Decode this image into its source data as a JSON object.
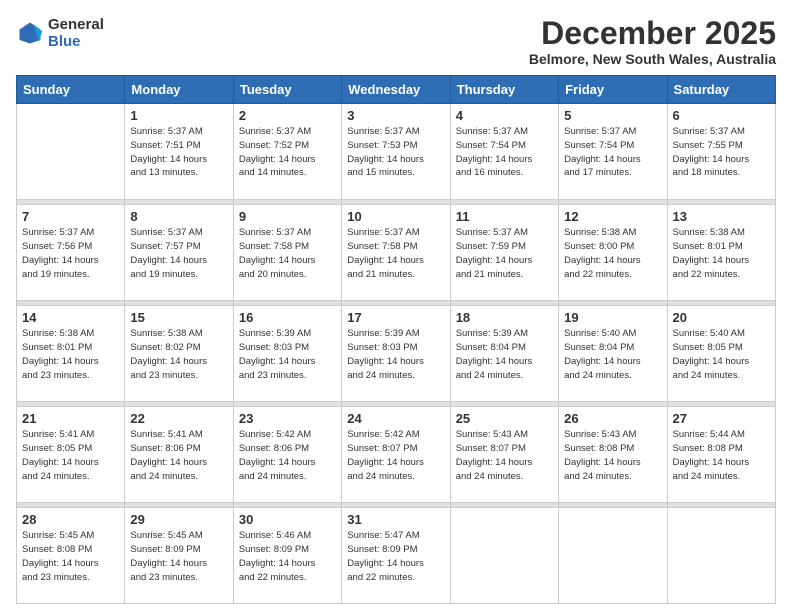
{
  "logo": {
    "line1": "General",
    "line2": "Blue"
  },
  "title": "December 2025",
  "subtitle": "Belmore, New South Wales, Australia",
  "weekdays": [
    "Sunday",
    "Monday",
    "Tuesday",
    "Wednesday",
    "Thursday",
    "Friday",
    "Saturday"
  ],
  "weeks": [
    [
      {
        "day": "",
        "info": ""
      },
      {
        "day": "1",
        "info": "Sunrise: 5:37 AM\nSunset: 7:51 PM\nDaylight: 14 hours\nand 13 minutes."
      },
      {
        "day": "2",
        "info": "Sunrise: 5:37 AM\nSunset: 7:52 PM\nDaylight: 14 hours\nand 14 minutes."
      },
      {
        "day": "3",
        "info": "Sunrise: 5:37 AM\nSunset: 7:53 PM\nDaylight: 14 hours\nand 15 minutes."
      },
      {
        "day": "4",
        "info": "Sunrise: 5:37 AM\nSunset: 7:54 PM\nDaylight: 14 hours\nand 16 minutes."
      },
      {
        "day": "5",
        "info": "Sunrise: 5:37 AM\nSunset: 7:54 PM\nDaylight: 14 hours\nand 17 minutes."
      },
      {
        "day": "6",
        "info": "Sunrise: 5:37 AM\nSunset: 7:55 PM\nDaylight: 14 hours\nand 18 minutes."
      }
    ],
    [
      {
        "day": "7",
        "info": "Sunrise: 5:37 AM\nSunset: 7:56 PM\nDaylight: 14 hours\nand 19 minutes."
      },
      {
        "day": "8",
        "info": "Sunrise: 5:37 AM\nSunset: 7:57 PM\nDaylight: 14 hours\nand 19 minutes."
      },
      {
        "day": "9",
        "info": "Sunrise: 5:37 AM\nSunset: 7:58 PM\nDaylight: 14 hours\nand 20 minutes."
      },
      {
        "day": "10",
        "info": "Sunrise: 5:37 AM\nSunset: 7:58 PM\nDaylight: 14 hours\nand 21 minutes."
      },
      {
        "day": "11",
        "info": "Sunrise: 5:37 AM\nSunset: 7:59 PM\nDaylight: 14 hours\nand 21 minutes."
      },
      {
        "day": "12",
        "info": "Sunrise: 5:38 AM\nSunset: 8:00 PM\nDaylight: 14 hours\nand 22 minutes."
      },
      {
        "day": "13",
        "info": "Sunrise: 5:38 AM\nSunset: 8:01 PM\nDaylight: 14 hours\nand 22 minutes."
      }
    ],
    [
      {
        "day": "14",
        "info": "Sunrise: 5:38 AM\nSunset: 8:01 PM\nDaylight: 14 hours\nand 23 minutes."
      },
      {
        "day": "15",
        "info": "Sunrise: 5:38 AM\nSunset: 8:02 PM\nDaylight: 14 hours\nand 23 minutes."
      },
      {
        "day": "16",
        "info": "Sunrise: 5:39 AM\nSunset: 8:03 PM\nDaylight: 14 hours\nand 23 minutes."
      },
      {
        "day": "17",
        "info": "Sunrise: 5:39 AM\nSunset: 8:03 PM\nDaylight: 14 hours\nand 24 minutes."
      },
      {
        "day": "18",
        "info": "Sunrise: 5:39 AM\nSunset: 8:04 PM\nDaylight: 14 hours\nand 24 minutes."
      },
      {
        "day": "19",
        "info": "Sunrise: 5:40 AM\nSunset: 8:04 PM\nDaylight: 14 hours\nand 24 minutes."
      },
      {
        "day": "20",
        "info": "Sunrise: 5:40 AM\nSunset: 8:05 PM\nDaylight: 14 hours\nand 24 minutes."
      }
    ],
    [
      {
        "day": "21",
        "info": "Sunrise: 5:41 AM\nSunset: 8:05 PM\nDaylight: 14 hours\nand 24 minutes."
      },
      {
        "day": "22",
        "info": "Sunrise: 5:41 AM\nSunset: 8:06 PM\nDaylight: 14 hours\nand 24 minutes."
      },
      {
        "day": "23",
        "info": "Sunrise: 5:42 AM\nSunset: 8:06 PM\nDaylight: 14 hours\nand 24 minutes."
      },
      {
        "day": "24",
        "info": "Sunrise: 5:42 AM\nSunset: 8:07 PM\nDaylight: 14 hours\nand 24 minutes."
      },
      {
        "day": "25",
        "info": "Sunrise: 5:43 AM\nSunset: 8:07 PM\nDaylight: 14 hours\nand 24 minutes."
      },
      {
        "day": "26",
        "info": "Sunrise: 5:43 AM\nSunset: 8:08 PM\nDaylight: 14 hours\nand 24 minutes."
      },
      {
        "day": "27",
        "info": "Sunrise: 5:44 AM\nSunset: 8:08 PM\nDaylight: 14 hours\nand 24 minutes."
      }
    ],
    [
      {
        "day": "28",
        "info": "Sunrise: 5:45 AM\nSunset: 8:08 PM\nDaylight: 14 hours\nand 23 minutes."
      },
      {
        "day": "29",
        "info": "Sunrise: 5:45 AM\nSunset: 8:09 PM\nDaylight: 14 hours\nand 23 minutes."
      },
      {
        "day": "30",
        "info": "Sunrise: 5:46 AM\nSunset: 8:09 PM\nDaylight: 14 hours\nand 22 minutes."
      },
      {
        "day": "31",
        "info": "Sunrise: 5:47 AM\nSunset: 8:09 PM\nDaylight: 14 hours\nand 22 minutes."
      },
      {
        "day": "",
        "info": ""
      },
      {
        "day": "",
        "info": ""
      },
      {
        "day": "",
        "info": ""
      }
    ]
  ]
}
